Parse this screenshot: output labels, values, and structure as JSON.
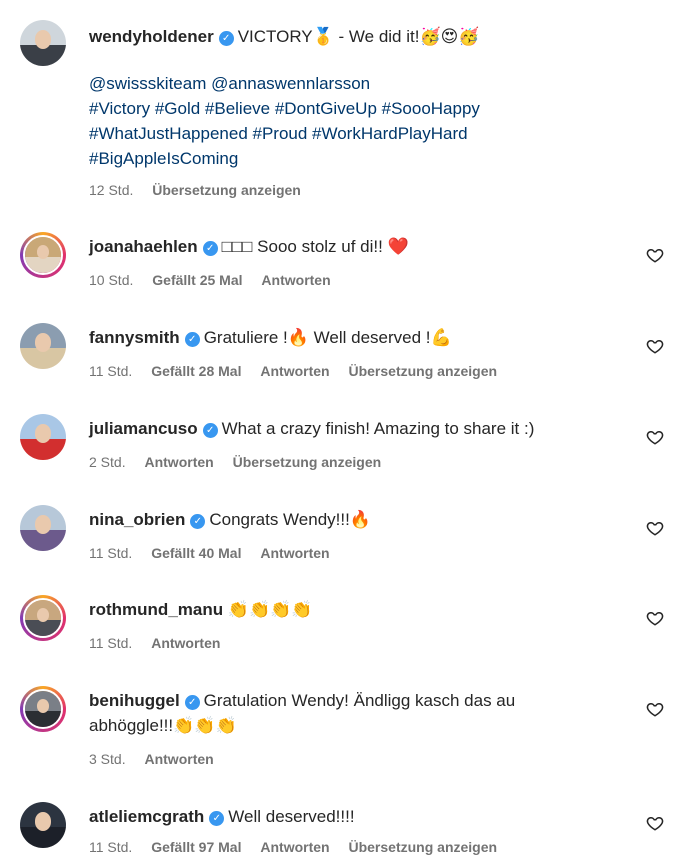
{
  "post": {
    "username": "wendyholdener",
    "caption": "VICTORY🥇 - We did it!🥳😍🥳",
    "mentions": "@swissskiteam @annaswennlarsson",
    "tags_line1": "#Victory #Gold #Believe #DontGiveUp #SoooHappy",
    "tags_line2": "#WhatJustHappened #Proud #WorkHardPlayHard",
    "tags_line3": "#BigAppleIsComing",
    "time": "12 Std.",
    "translate": "Übersetzung anzeigen"
  },
  "comments": [
    {
      "username": "joanahaehlen",
      "text": "□□□ Sooo stolz uf di!! ❤️",
      "time": "10 Std.",
      "likes": "Gefällt 25 Mal",
      "reply": "Antworten",
      "translate": ""
    },
    {
      "username": "fannysmith",
      "text": "Gratuliere !🔥 Well deserved !💪",
      "time": "11 Std.",
      "likes": "Gefällt 28 Mal",
      "reply": "Antworten",
      "translate": "Übersetzung anzeigen"
    },
    {
      "username": "juliamancuso",
      "text": "What a crazy finish! Amazing to share it :)",
      "time": "2 Std.",
      "likes": "",
      "reply": "Antworten",
      "translate": "Übersetzung anzeigen"
    },
    {
      "username": "nina_obrien",
      "text": "Congrats Wendy!!!🔥",
      "time": "11 Std.",
      "likes": "Gefällt 40 Mal",
      "reply": "Antworten",
      "translate": ""
    },
    {
      "username": "rothmund_manu",
      "text": "👏👏👏👏",
      "time": "11 Std.",
      "likes": "",
      "reply": "Antworten",
      "translate": ""
    },
    {
      "username": "benihuggel",
      "text": "Gratulation Wendy! Ändligg kasch das au",
      "text2": "abhöggle!!!👏👏👏",
      "time": "3 Std.",
      "likes": "",
      "reply": "Antworten",
      "translate": ""
    },
    {
      "username": "atleliemcgrath",
      "text": "Well deserved!!!!",
      "time": "11 Std.",
      "likes": "Gefällt 97 Mal",
      "reply": "Antworten",
      "translate": "Übersetzung anzeigen"
    }
  ],
  "icons": {
    "like": "heart-outline-icon",
    "verified": "verified-badge-icon"
  },
  "colors": {
    "verified": "#3897f0",
    "link": "#00376b",
    "muted": "#737373",
    "text": "#262626"
  }
}
